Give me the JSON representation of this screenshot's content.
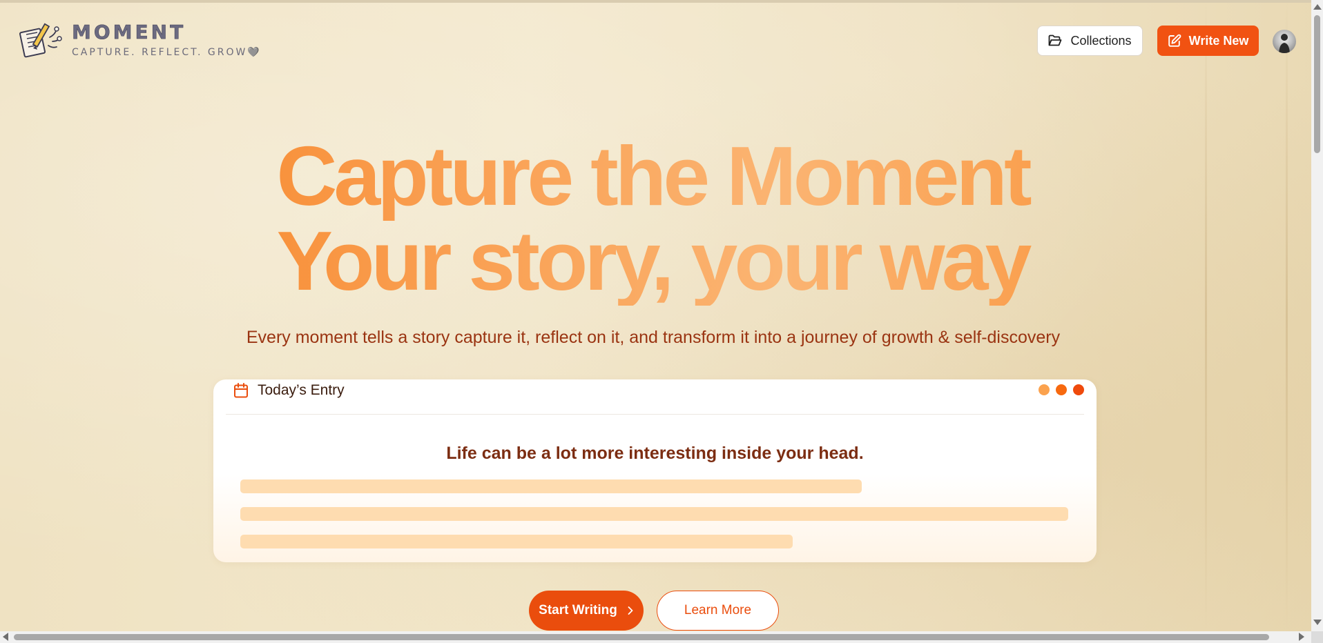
{
  "header": {
    "brand_name": "MOMENT",
    "tagline": "CAPTURE. REFLECT. GROW",
    "tagline_heart": "🩶",
    "collections_label": "Collections",
    "write_new_label": "Write New"
  },
  "hero": {
    "line1": "Capture the Moment",
    "line2": "Your story, your way",
    "subtitle": "Every moment tells a story capture it, reflect on it, and transform it into a journey of growth & self-discovery"
  },
  "entry_card": {
    "title": "Today’s Entry",
    "quote": "Life can be a lot more interesting inside your head."
  },
  "cta": {
    "start_label": "Start Writing",
    "learn_label": "Learn More"
  },
  "icons": {
    "logo": "notebook-pencil-logo-icon",
    "collections": "folder-open-icon",
    "write_new": "edit-square-icon",
    "entry": "calendar-icon",
    "start": "chevron-right-icon"
  },
  "colors": {
    "accent": "#f15212",
    "hero_gradient_start": "#f77d1a",
    "hero_gradient_mid": "#fbb472",
    "subtitle": "#9a3412",
    "quote": "#7c2d12",
    "skeleton": "#fedcb0",
    "dot_light": "#fba24e",
    "dot_mid": "#f7690f",
    "dot_dark": "#ef4a0c"
  }
}
